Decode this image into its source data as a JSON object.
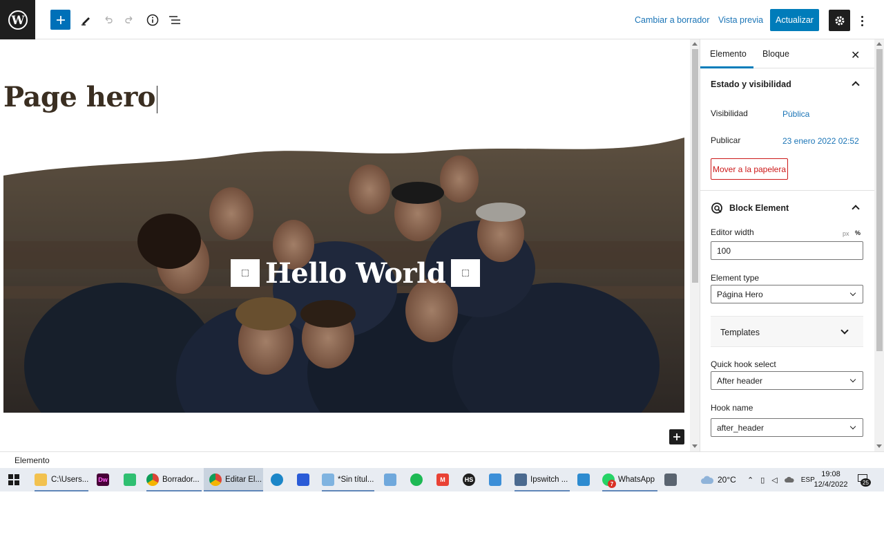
{
  "toolbar": {
    "switch_to_draft": "Cambiar a borrador",
    "preview": "Vista previa",
    "update": "Actualizar"
  },
  "editor": {
    "page_title": "Page hero",
    "hero_heading": "Hello World"
  },
  "sidebar": {
    "tabs": [
      "Elemento",
      "Bloque"
    ],
    "status_panel": {
      "title": "Estado y visibilidad",
      "visibility_label": "Visibilidad",
      "visibility_value": "Pública",
      "publish_label": "Publicar",
      "publish_value": "23 enero 2022 02:52",
      "trash_button": "Mover a la papelera"
    },
    "block_panel": {
      "title": "Block Element",
      "editor_width_label": "Editor width",
      "unit_px": "px",
      "unit_percent": "%",
      "editor_width_value": "100",
      "element_type_label": "Element type",
      "element_type_value": "Página Hero",
      "templates_label": "Templates",
      "quick_hook_label": "Quick hook select",
      "quick_hook_value": "After header",
      "hook_name_label": "Hook name",
      "hook_name_value": "after_header"
    }
  },
  "footer": {
    "breadcrumb": "Elemento"
  },
  "taskbar": {
    "items": [
      {
        "label": "C:\\Users...",
        "icon": "folder-icon"
      },
      {
        "label": "",
        "icon": "dreamweaver-icon",
        "text": "Dw"
      },
      {
        "label": "",
        "icon": "green-app-icon"
      },
      {
        "label": "Borrador...",
        "icon": "chrome-icon"
      },
      {
        "label": "Editar El...",
        "icon": "chrome-icon"
      },
      {
        "label": "",
        "icon": "edge-icon"
      },
      {
        "label": "",
        "icon": "app-icon"
      },
      {
        "label": "*Sin títul...",
        "icon": "notepad-icon"
      },
      {
        "label": "",
        "icon": "paint-icon"
      },
      {
        "label": "",
        "icon": "spotify-icon"
      },
      {
        "label": "",
        "icon": "gmail-icon"
      },
      {
        "label": "",
        "icon": "hs-icon",
        "text": "HS"
      },
      {
        "label": "",
        "icon": "screen-icon"
      },
      {
        "label": "Ipswitch ...",
        "icon": "ipswitch-icon"
      },
      {
        "label": "",
        "icon": "camera-icon"
      },
      {
        "label": "WhatsApp",
        "icon": "whatsapp-icon",
        "badge": "7"
      },
      {
        "label": "",
        "icon": "calculator-icon"
      }
    ],
    "weather": "20°C",
    "language": "ESP",
    "time": "19:08",
    "date": "12/4/2022",
    "notification_count": "25"
  },
  "colors": {
    "accent": "#007cba",
    "danger": "#cc1818",
    "dark": "#1e1e1e"
  }
}
